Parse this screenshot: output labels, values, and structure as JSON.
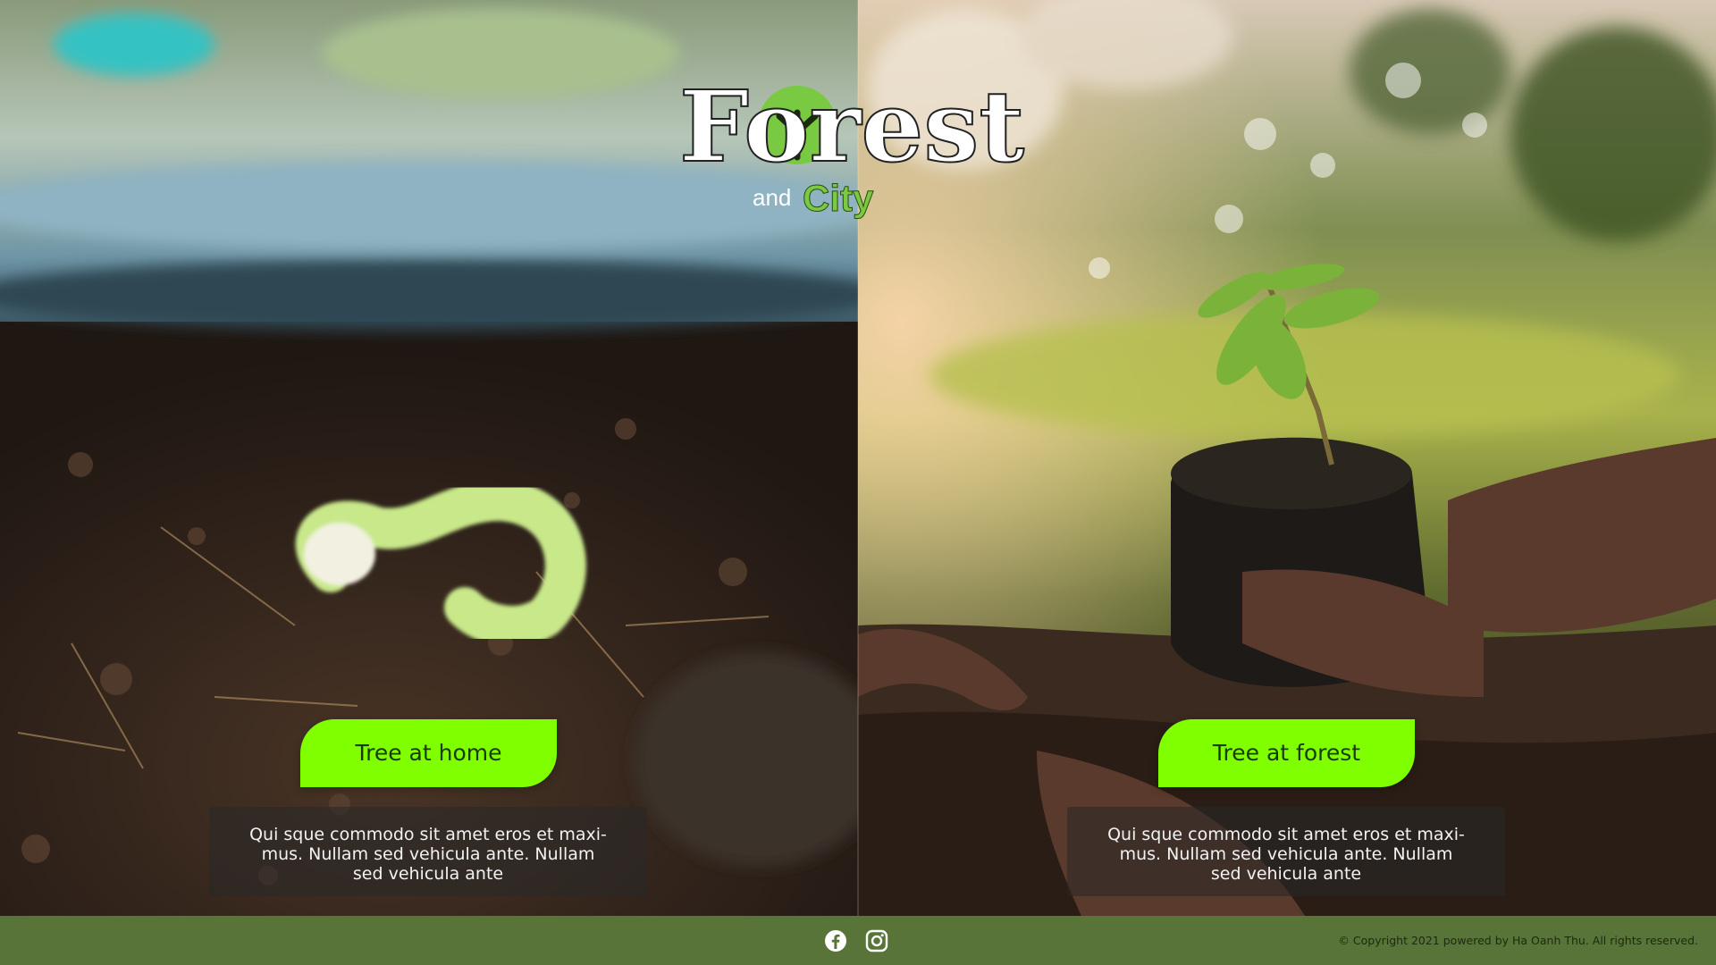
{
  "brand": {
    "logo_word_main": "Forest",
    "logo_word_and": "and",
    "logo_word_city": "City"
  },
  "panels": [
    {
      "button_label": "Tree at home",
      "description": "Qui sque commodo sit amet eros et maxi-mus. Nullam sed vehicula ante. Nullam sed vehicula ante"
    },
    {
      "button_label": "Tree at forest",
      "description": "Qui sque commodo sit amet eros et maxi-mus. Nullam sed vehicula ante. Nullam sed vehicula ante"
    }
  ],
  "footer": {
    "social": [
      "facebook-icon",
      "instagram-icon"
    ],
    "copyright": "© Copyright 2021 powered by Ha Oanh Thu. All rights reserved."
  },
  "colors": {
    "button": "#80ff00",
    "footer": "#587438",
    "logo_green": "#7ac943"
  }
}
